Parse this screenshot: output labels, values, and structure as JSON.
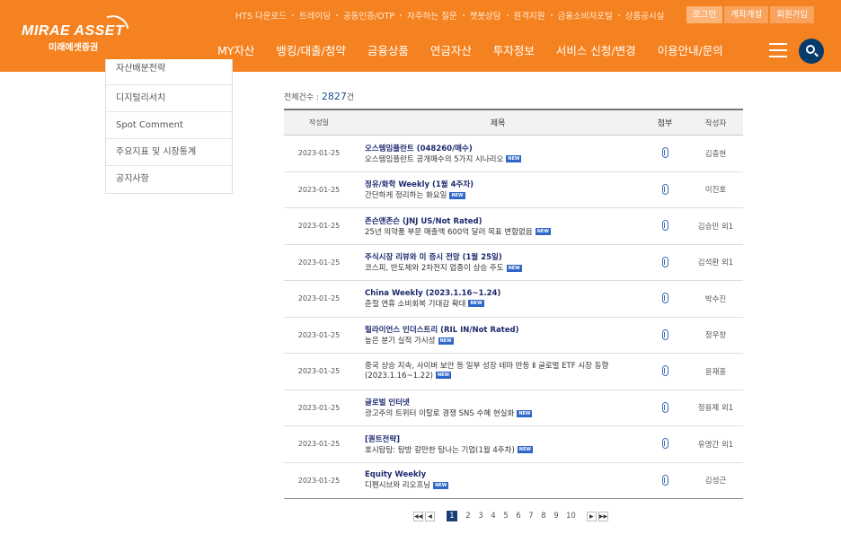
{
  "brand": {
    "logo_main": "MIRAE ASSET",
    "logo_sub": "미래에셋증권"
  },
  "util_links": [
    "HTS 다운로드",
    "트레이딩",
    "공동인증/OTP",
    "자주하는 질문",
    "챗봇상담",
    "원격지원",
    "금융소비자포털",
    "상품공시실"
  ],
  "auth_buttons": [
    "로그인",
    "계좌개설",
    "회원가입"
  ],
  "gnb": [
    "MY자산",
    "뱅킹/대출/청약",
    "금융상품",
    "연금자산",
    "투자정보",
    "서비스 신청/변경",
    "이용안내/문의"
  ],
  "sidebar": {
    "items": [
      "자산배분전략",
      "디지털리서치",
      "Spot Comment",
      "주요지표 및 시장통계",
      "공지사항"
    ]
  },
  "count": {
    "label": "전체건수 :",
    "value": "2827",
    "unit": "건"
  },
  "table": {
    "headers": {
      "date": "작성일",
      "title": "제목",
      "attach": "첨부",
      "author": "작성자"
    },
    "new_badge": "NEW",
    "rows": [
      {
        "date": "2023-01-25",
        "title": "오스템임플란트 (048260/매수)",
        "summary": "오스템임플란트 공개매수의 5가지 시나리오",
        "author": "김충현"
      },
      {
        "date": "2023-01-25",
        "title": "정유/화학 Weekly (1월 4주차)",
        "summary": "간단하게 정리하는 화요일",
        "author": "이진호"
      },
      {
        "date": "2023-01-25",
        "title": "존슨앤존슨 (JNJ US/Not Rated)",
        "summary": "25년 의약품 부문 매출액 600억 달러 목표 변함없음",
        "author": "김승민 외1"
      },
      {
        "date": "2023-01-25",
        "title": "주식시장 리뷰와 미 증시 전망 (1월 25일)",
        "summary": "코스피, 반도체와 2차전지 업종이 상승 주도",
        "author": "김석환 외1"
      },
      {
        "date": "2023-01-25",
        "title": "China Weekly (2023.1.16~1.24)",
        "summary": "춘절 연휴 소비회복 기대감 확대",
        "author": "박수진"
      },
      {
        "date": "2023-01-25",
        "title": "릴라이언스 인더스트리 (RIL IN/Not Rated)",
        "summary": "높은 분기 실적 가시성",
        "author": "정우창"
      },
      {
        "date": "2023-01-25",
        "title": "",
        "summary": "중국 상승 지속, 사이버 보안 등 일부 성장 테마 반등 Ⅱ 글로벌 ETF 시장 동향(2023.1.16~1.22)",
        "author": "윤재홍"
      },
      {
        "date": "2023-01-25",
        "title": "글로벌 인터넷",
        "summary": "광고주의 트위터 이탈로 경쟁 SNS 수혜 현실화",
        "author": "정용제 외1"
      },
      {
        "date": "2023-01-25",
        "title": "[퀀트전략]",
        "summary": "호시탐탐: 탐방 갈만한 탐나는 기업(1월 4주차)",
        "author": "유명간 외1"
      },
      {
        "date": "2023-01-25",
        "title": "Equity Weekly",
        "summary": "디펜시브와 리오프닝",
        "author": "김성근"
      }
    ]
  },
  "pager": {
    "first": "◀◀",
    "prev": "◀",
    "pages": [
      "1",
      "2",
      "3",
      "4",
      "5",
      "6",
      "7",
      "8",
      "9",
      "10"
    ],
    "next": "▶",
    "last": "▶▶",
    "current": "1"
  }
}
